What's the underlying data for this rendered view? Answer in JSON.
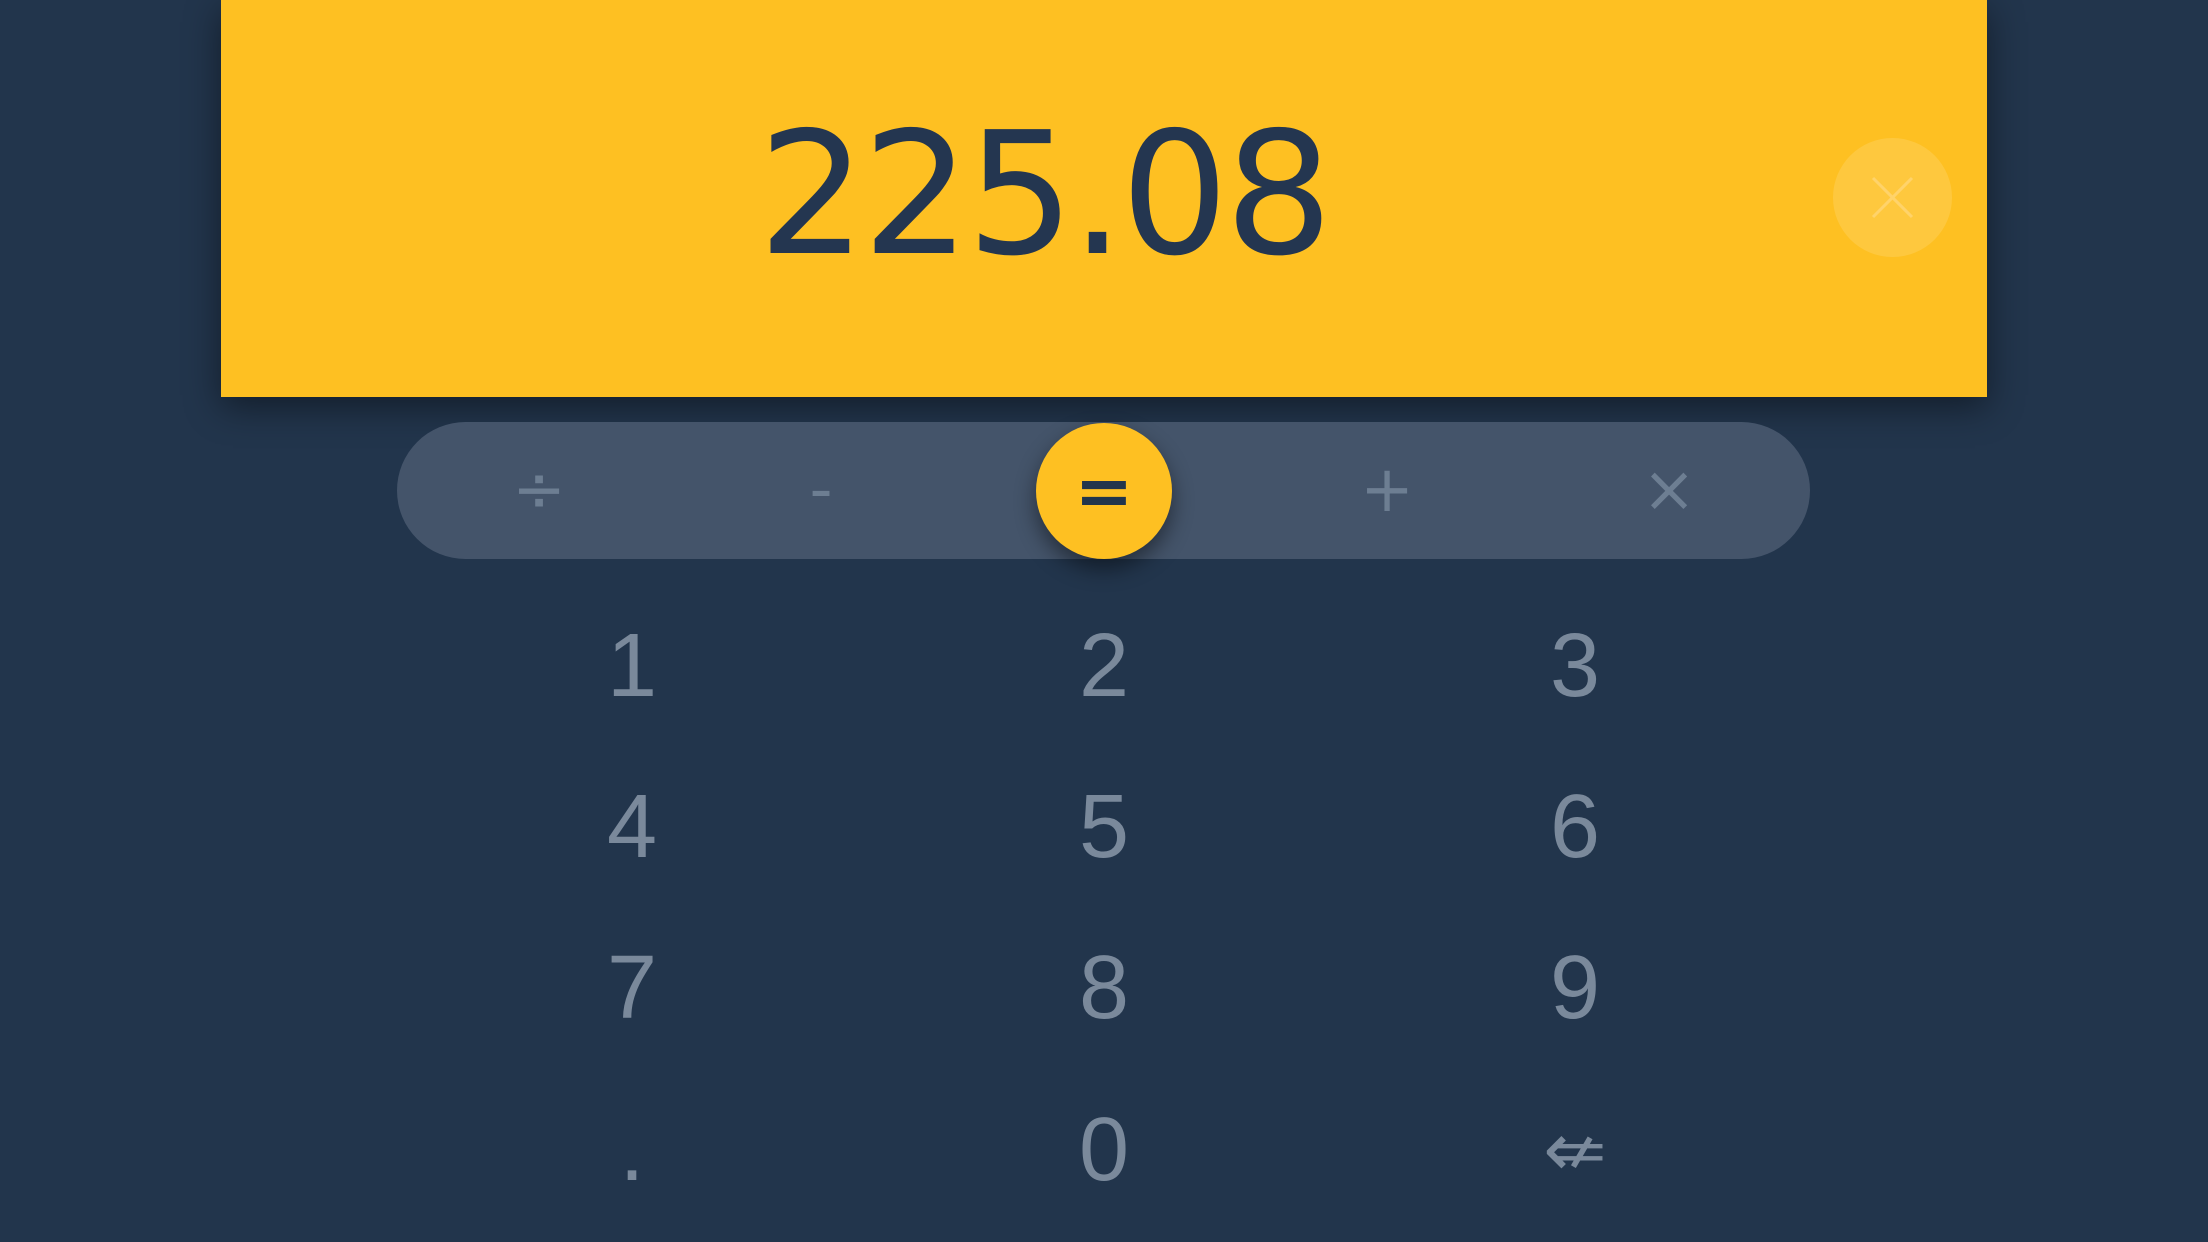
{
  "display": {
    "value": "225.08",
    "clear_icon": "close-icon"
  },
  "operators": {
    "divide": "÷",
    "subtract": "-",
    "equals": "=",
    "add": "+",
    "multiply": "×"
  },
  "keypad": {
    "k1": "1",
    "k2": "2",
    "k3": "3",
    "k4": "4",
    "k5": "5",
    "k6": "6",
    "k7": "7",
    "k8": "8",
    "k9": "9",
    "decimal": ".",
    "k0": "0",
    "backspace": "⇍"
  },
  "colors": {
    "background": "#22354c",
    "accent": "#fec022",
    "operator_bar": "#44546a",
    "key_text": "#7a899b"
  }
}
